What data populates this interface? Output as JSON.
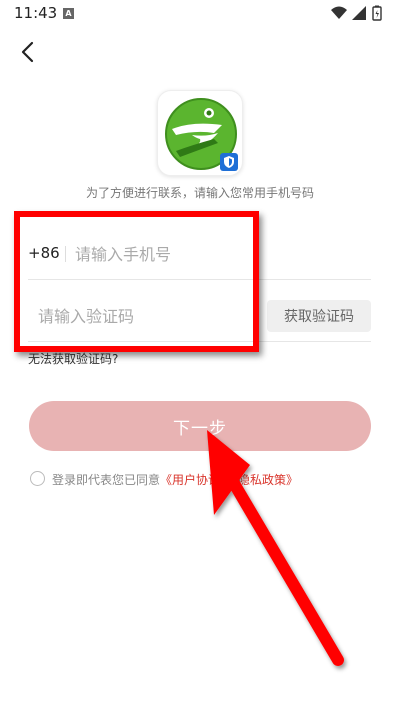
{
  "status_bar": {
    "time": "11:43",
    "notification_icon": "A"
  },
  "header": {
    "back_icon": "chevron-left-icon"
  },
  "logo": {
    "icon": "app-logo-icon",
    "badge_icon": "shield-badge-icon"
  },
  "subtitle": "为了方便进行联系，请输入您常用手机号码",
  "phone": {
    "country_code": "+86",
    "placeholder": "请输入手机号"
  },
  "verify": {
    "placeholder": "请输入验证码",
    "get_code_label": "获取验证码"
  },
  "cant_get_code": "无法获取验证码?",
  "next_button": "下一步",
  "agreement": {
    "prefix": "登录即代表您已同意",
    "user_agreement": "《用户协议》",
    "and": "",
    "privacy_policy": "《隐私政策》"
  },
  "colors": {
    "highlight": "#ff0000",
    "next_button_bg": "#e8b3b3",
    "link": "#d9342b",
    "logo_green": "#5bb52f"
  }
}
